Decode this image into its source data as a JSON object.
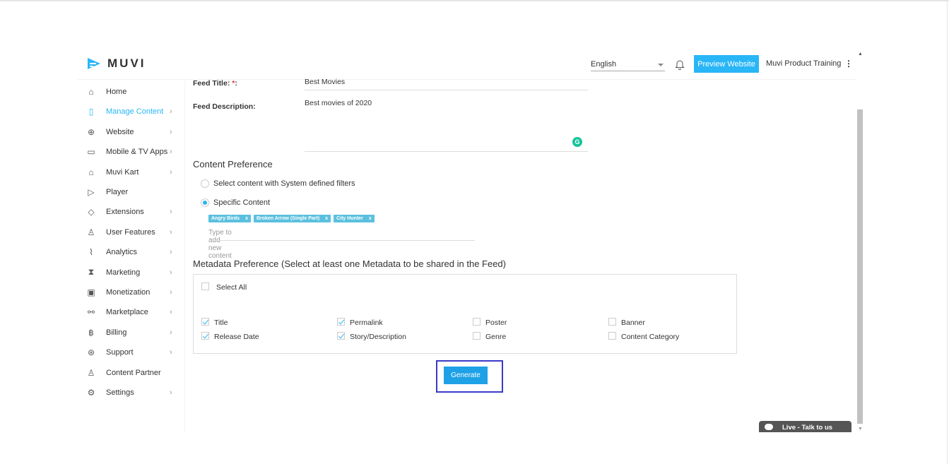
{
  "header": {
    "logo": "MUVI",
    "language": "English",
    "preview_label": "Preview Website",
    "user": "Muvi Product Training"
  },
  "sidebar": {
    "items": [
      {
        "label": "Home",
        "icon": "home-icon",
        "glyph": "⌂",
        "chev": false
      },
      {
        "label": "Manage Content",
        "icon": "content-icon",
        "glyph": "▯",
        "chev": true,
        "active": true
      },
      {
        "label": "Website",
        "icon": "globe-icon",
        "glyph": "⊕",
        "chev": true
      },
      {
        "label": "Mobile & TV Apps",
        "icon": "monitor-icon",
        "glyph": "▭",
        "chev": true
      },
      {
        "label": "Muvi Kart",
        "icon": "bag-icon",
        "glyph": "⌂",
        "chev": true
      },
      {
        "label": "Player",
        "icon": "play-icon",
        "glyph": "▷",
        "chev": false
      },
      {
        "label": "Extensions",
        "icon": "tag-icon",
        "glyph": "◇",
        "chev": true
      },
      {
        "label": "User Features",
        "icon": "user-icon",
        "glyph": "♙",
        "chev": true
      },
      {
        "label": "Analytics",
        "icon": "chart-icon",
        "glyph": "⌇",
        "chev": true
      },
      {
        "label": "Marketing",
        "icon": "hourglass-icon",
        "glyph": "⧗",
        "chev": true
      },
      {
        "label": "Monetization",
        "icon": "money-icon",
        "glyph": "▣",
        "chev": true
      },
      {
        "label": "Marketplace",
        "icon": "link-icon",
        "glyph": "⚯",
        "chev": true
      },
      {
        "label": "Billing",
        "icon": "bitcoin-icon",
        "glyph": "฿",
        "chev": true
      },
      {
        "label": "Support",
        "icon": "support-icon",
        "glyph": "⊛",
        "chev": true
      },
      {
        "label": "Content Partner",
        "icon": "partner-icon",
        "glyph": "♙",
        "chev": false
      },
      {
        "label": "Settings",
        "icon": "gear-icon",
        "glyph": "⚙",
        "chev": true
      }
    ]
  },
  "form": {
    "feed_title_label": "Feed Title:",
    "required_mark": "*",
    "colon": ":",
    "feed_title_value": "Best Movies",
    "feed_description_label": "Feed Description:",
    "feed_description_value": "Best movies of 2020",
    "content_pref_heading": "Content Preference",
    "radio_system": "Select content with System defined filters",
    "radio_specific": "Specific Content",
    "tags": [
      "Angry Birds",
      "Broken Arrow (Single Part)",
      "City Hunter"
    ],
    "tag_remove": "x",
    "content_placeholder": "Type to add new content",
    "metadata_heading": "Metadata Preference (Select at least one Metadata to be shared in the Feed)",
    "select_all": "Select All",
    "metadata": [
      {
        "label": "Title",
        "checked": true
      },
      {
        "label": "Permalink",
        "checked": true
      },
      {
        "label": "Poster",
        "checked": false
      },
      {
        "label": "Banner",
        "checked": false
      },
      {
        "label": "Release Date",
        "checked": true
      },
      {
        "label": "Story/Description",
        "checked": true
      },
      {
        "label": "Genre",
        "checked": false
      },
      {
        "label": "Content Category",
        "checked": false
      }
    ],
    "generate_label": "Generate"
  },
  "chat": {
    "label": "Live - Talk to us"
  },
  "colors": {
    "accent": "#29b6f6",
    "tag": "#5bc0de",
    "highlight": "#3a3ac8"
  }
}
